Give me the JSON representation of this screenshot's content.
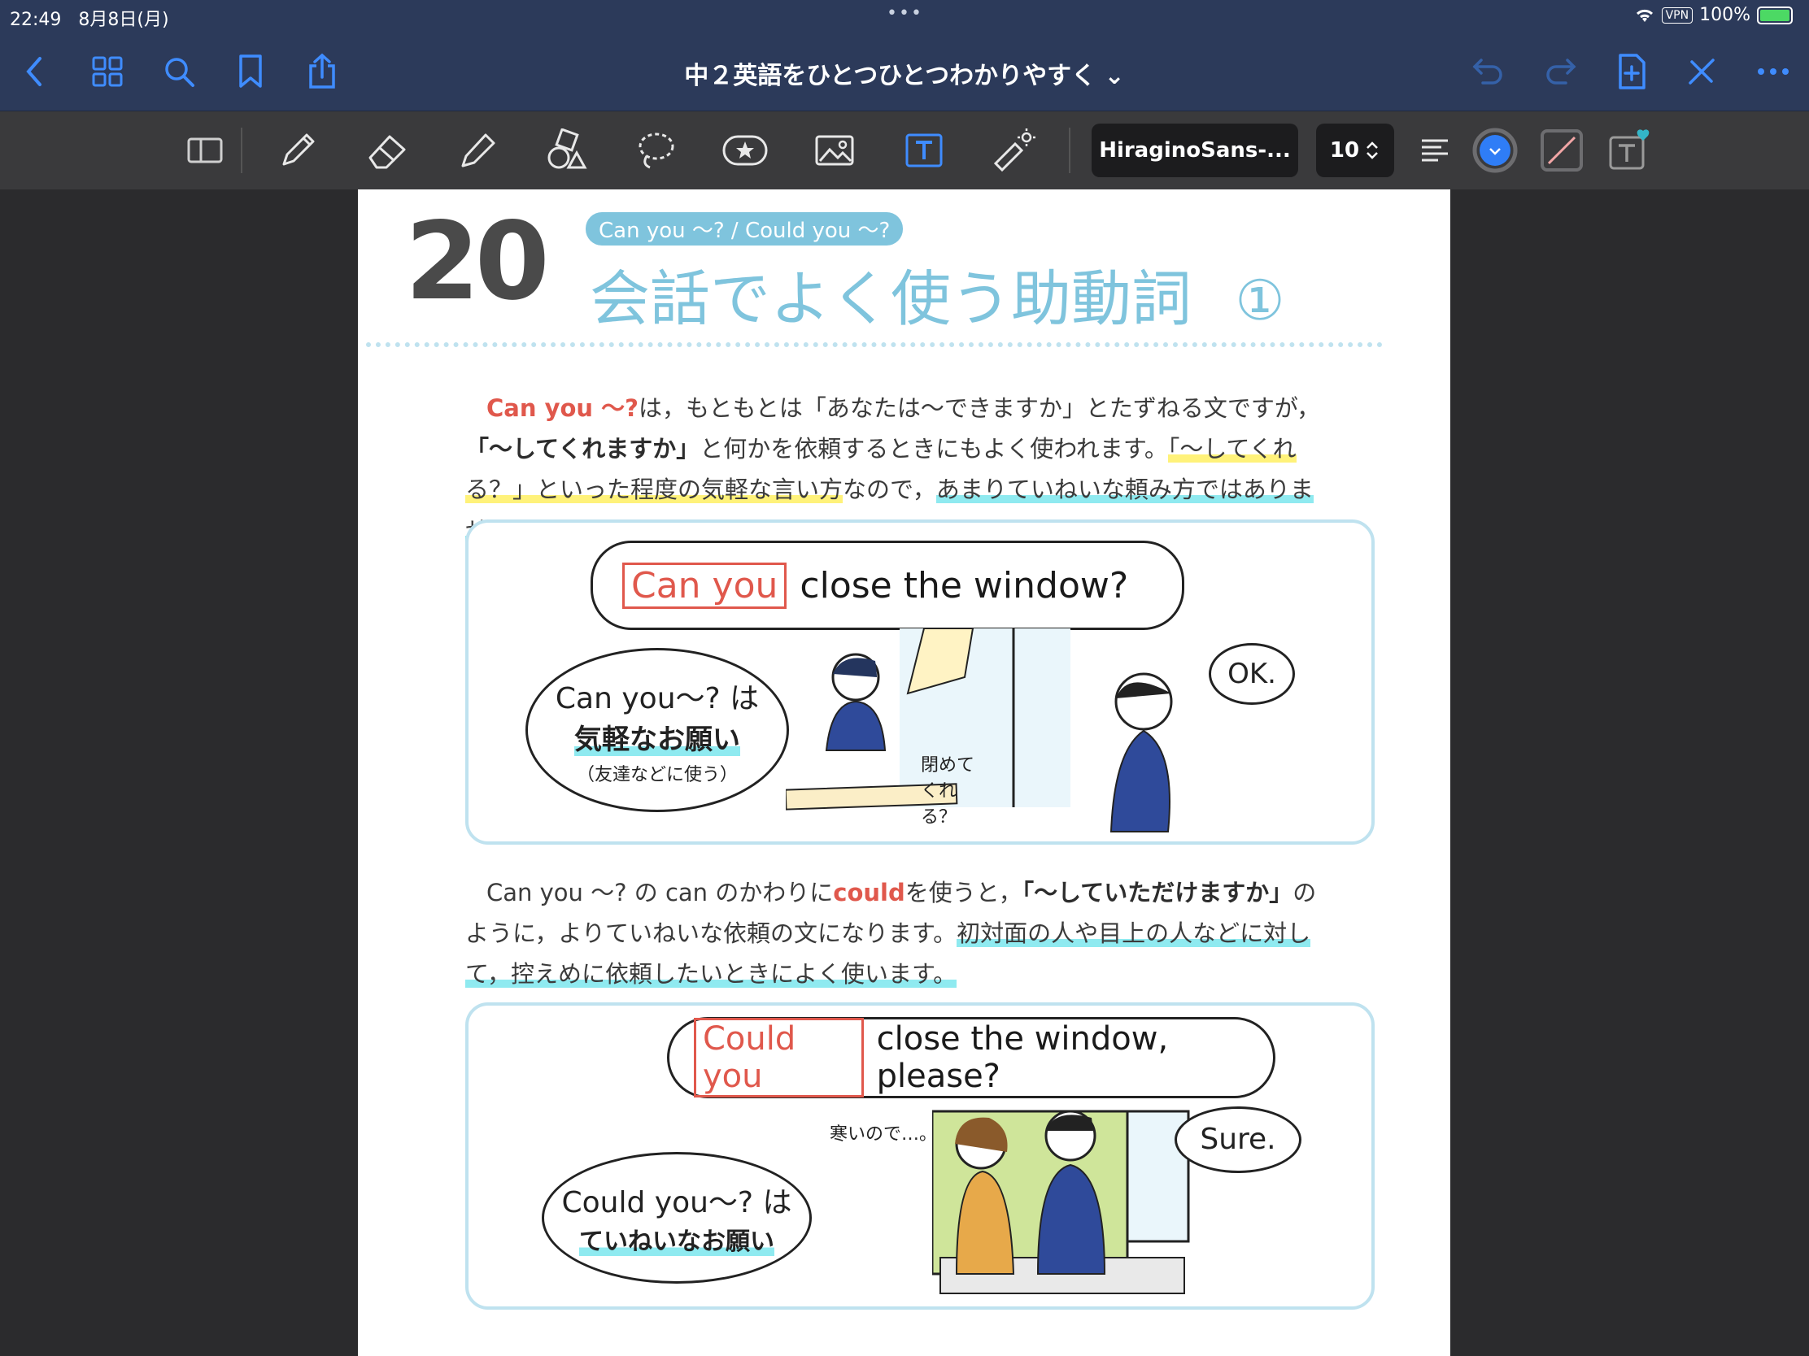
{
  "status": {
    "time": "22:49",
    "date": "8月8日(月)",
    "dots": "•••",
    "vpn": "VPN",
    "battery": "100%"
  },
  "nav": {
    "title": "中２英語をひとつひとつわかりやすく ⌄"
  },
  "toolbar": {
    "font_name": "HiraginoSans-...",
    "font_size": "10",
    "accent": "#2f7df6"
  },
  "page": {
    "lesson_number": "20",
    "lesson_tag": "Can you ～? / Could you ～?",
    "lesson_title": "会話でよく使う助動詞",
    "lesson_circle": "①",
    "para1": {
      "p1": "Can you ～?",
      "p2": "は，もともとは「あなたは～できますか」とたずねる文ですが，",
      "p3": "「～してくれますか」",
      "p4": "と何かを依頼するときにもよく使われます。",
      "p5": "「～してくれる？」といった程度の気軽な言い方",
      "p6": "なので，",
      "p7": "あまりていねいな頼み方ではありません。"
    },
    "panel1": {
      "speech_red": "Can you",
      "speech_rest": "close the window?",
      "oval_line1": "Can you～? は",
      "oval_line2": "気軽なお願い",
      "oval_line3": "（友達などに使う）",
      "side_note": "閉めて くれる？",
      "reply": "OK."
    },
    "para2": {
      "p1": "Can you ～? の can のかわりに",
      "p2": "could",
      "p3": "を使うと，",
      "p4": "「～していただけますか」",
      "p5": "のように，よりていねいな依頼の文になります。",
      "p6": "初対面の人や目上の人などに対して，控えめに依頼したいときによく使います。"
    },
    "panel2": {
      "speech_red": "Could you",
      "speech_rest": "close the window, please?",
      "oval_line1": "Could you～? は",
      "oval_line2": "ていねいなお願い",
      "side_note": "寒いので…。",
      "reply": "Sure."
    }
  }
}
